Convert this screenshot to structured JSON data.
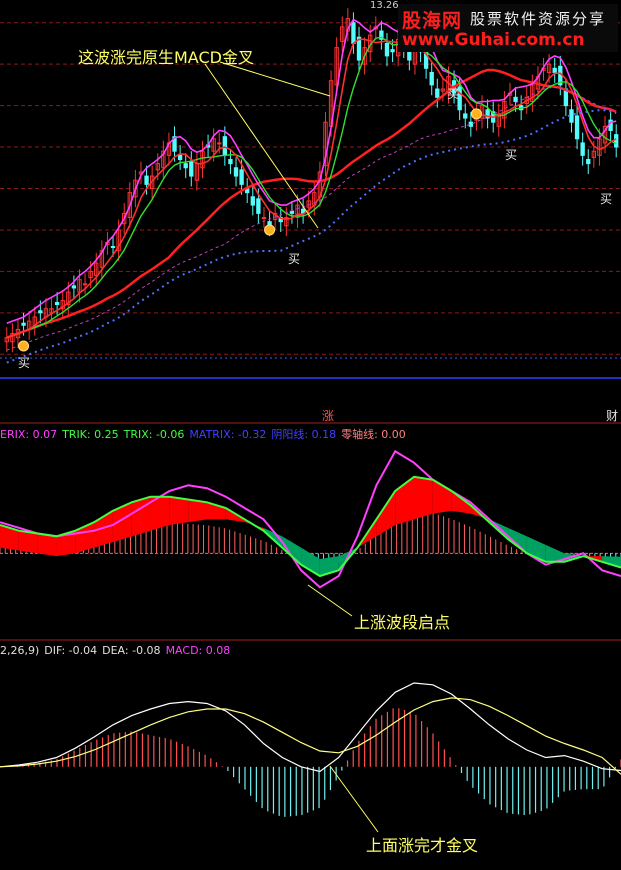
{
  "watermark": {
    "logo": "股海网",
    "subtitle": "股票软件资源分享",
    "url": "www.Guhai.com.cn"
  },
  "price_label": "13.26",
  "annotations": {
    "top": "这波涨完原生MACD金叉",
    "middle": "上涨波段启点",
    "bottom": "上面涨完才金叉"
  },
  "buy_label": "买",
  "separator_labels": {
    "center": "涨",
    "right": "财"
  },
  "indicator1_legend": [
    {
      "text": "ERIX: 0.07",
      "color": "#ff40ff"
    },
    {
      "text": "TRIK: 0.25",
      "color": "#40ff40"
    },
    {
      "text": "TRIX: -0.06",
      "color": "#40ff40"
    },
    {
      "text": "MATRIX: -0.32",
      "color": "#4040ff"
    },
    {
      "text": "阴阳线: 0.18",
      "color": "#4040ff"
    },
    {
      "text": "零轴线: 0.00",
      "color": "#ff8080"
    }
  ],
  "indicator2_legend": [
    {
      "text": "2,26,9)",
      "color": "#e0e0e0"
    },
    {
      "text": "DIF: -0.04",
      "color": "#e0e0e0"
    },
    {
      "text": "DEA: -0.08",
      "color": "#e0e0e0"
    },
    {
      "text": "MACD: 0.08",
      "color": "#ff40ff"
    }
  ],
  "colors": {
    "up": "#ff3232",
    "down": "#54fcfc",
    "ma_long": "#ff2020",
    "ma_fast": "#ff40ff",
    "ma_mid": "#30e030",
    "dots": "#5070ff",
    "ribbon_up": "#ff0000",
    "ribbon_down": "#00a060",
    "grid": "#8b1a1a"
  },
  "chart_data": {
    "type": "line",
    "candle_count": 110,
    "price_series": {
      "close": [
        5.4,
        5.5,
        5.6,
        5.7,
        5.8,
        5.9,
        6.0,
        6.1,
        6.1,
        6.2,
        6.3,
        6.5,
        6.6,
        6.8,
        6.7,
        7.0,
        7.2,
        7.5,
        7.7,
        7.6,
        8.0,
        8.4,
        8.9,
        9.2,
        9.4,
        9.1,
        9.3,
        9.6,
        9.9,
        10.1,
        9.9,
        9.7,
        9.5,
        9.3,
        9.6,
        9.9,
        10.0,
        10.2,
        10.1,
        9.8,
        9.6,
        9.3,
        9.1,
        8.9,
        8.6,
        8.4,
        8.3,
        8.1,
        8.4,
        8.2,
        8.3,
        8.4,
        8.6,
        8.4,
        8.7,
        8.9,
        9.4,
        10.6,
        11.6,
        12.4,
        12.9,
        13.1,
        12.5,
        12.1,
        12.4,
        12.7,
        12.9,
        12.6,
        12.2,
        12.3,
        12.6,
        12.4,
        12.1,
        12.5,
        12.3,
        11.9,
        11.5,
        11.2,
        11.4,
        11.7,
        11.3,
        10.9,
        10.7,
        10.5,
        10.8,
        11.0,
        10.7,
        10.6,
        10.8,
        11.1,
        11.3,
        11.1,
        10.9,
        11.2,
        11.5,
        11.7,
        11.9,
        12.0,
        11.8,
        11.5,
        11.0,
        10.6,
        10.2,
        9.8,
        9.6,
        9.9,
        10.2,
        10.5,
        10.4,
        10.0
      ],
      "ylim": [
        4.5,
        13.5
      ]
    },
    "indicator1": {
      "series": [
        {
          "name": "ERIX",
          "values": [
            0.55,
            0.45,
            0.35,
            0.3,
            0.35,
            0.4,
            0.5,
            0.7,
            0.9,
            1.1,
            1.2,
            1.15,
            1.0,
            0.8,
            0.6,
            0.2,
            -0.3,
            -0.6,
            -0.4,
            0.3,
            1.2,
            1.8,
            1.6,
            1.3,
            1.1,
            0.9,
            0.6,
            0.3,
            0.0,
            -0.2,
            -0.1,
            0.0,
            -0.3,
            -0.4
          ]
        },
        {
          "name": "TRIK",
          "values": [
            0.5,
            0.4,
            0.35,
            0.3,
            0.4,
            0.55,
            0.75,
            0.9,
            1.0,
            1.0,
            0.95,
            0.9,
            0.8,
            0.6,
            0.4,
            0.1,
            -0.2,
            -0.4,
            -0.3,
            0.1,
            0.6,
            1.1,
            1.35,
            1.3,
            1.1,
            0.85,
            0.55,
            0.25,
            0.0,
            -0.15,
            -0.15,
            -0.05,
            -0.15,
            -0.25
          ]
        },
        {
          "name": "TRIX",
          "values": [
            0.1,
            0.05,
            0.0,
            -0.05,
            0.0,
            0.1,
            0.2,
            0.3,
            0.4,
            0.5,
            0.55,
            0.6,
            0.6,
            0.55,
            0.45,
            0.3,
            0.1,
            -0.1,
            -0.05,
            0.1,
            0.3,
            0.5,
            0.6,
            0.7,
            0.75,
            0.7,
            0.6,
            0.45,
            0.3,
            0.15,
            0.0,
            -0.05,
            -0.05,
            -0.06
          ]
        }
      ],
      "ylim": [
        -1.0,
        2.0
      ]
    },
    "indicator2": {
      "series": [
        {
          "name": "DIF",
          "values": [
            0.0,
            0.02,
            0.05,
            0.1,
            0.2,
            0.32,
            0.45,
            0.55,
            0.62,
            0.68,
            0.7,
            0.68,
            0.6,
            0.45,
            0.25,
            0.1,
            0.0,
            -0.05,
            0.1,
            0.35,
            0.6,
            0.8,
            0.9,
            0.88,
            0.78,
            0.62,
            0.45,
            0.3,
            0.18,
            0.1,
            0.12,
            0.06,
            -0.02,
            -0.04
          ]
        },
        {
          "name": "DEA",
          "values": [
            0.0,
            0.01,
            0.03,
            0.06,
            0.11,
            0.18,
            0.27,
            0.36,
            0.45,
            0.53,
            0.59,
            0.62,
            0.62,
            0.57,
            0.48,
            0.37,
            0.26,
            0.17,
            0.15,
            0.22,
            0.34,
            0.48,
            0.61,
            0.7,
            0.74,
            0.72,
            0.65,
            0.55,
            0.44,
            0.33,
            0.25,
            0.18,
            0.1,
            -0.08
          ]
        },
        {
          "name": "MACD",
          "values": [
            0.0,
            0.02,
            0.04,
            0.08,
            0.18,
            0.28,
            0.36,
            0.38,
            0.34,
            0.3,
            0.22,
            0.12,
            -0.02,
            -0.24,
            -0.46,
            -0.54,
            -0.52,
            -0.44,
            -0.1,
            0.26,
            0.52,
            0.64,
            0.58,
            0.36,
            0.08,
            -0.2,
            -0.4,
            -0.5,
            -0.52,
            -0.46,
            -0.26,
            -0.24,
            -0.24,
            0.08
          ]
        }
      ],
      "ylim": [
        -1.0,
        1.2
      ]
    }
  }
}
